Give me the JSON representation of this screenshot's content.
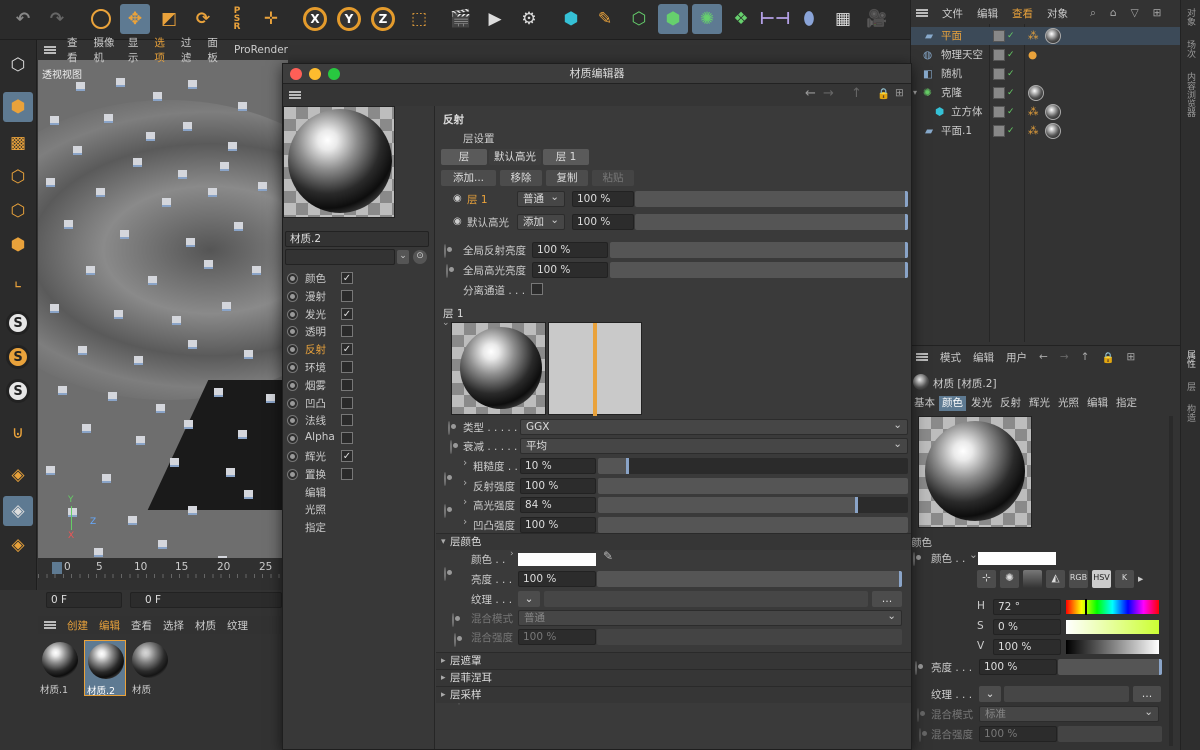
{
  "object_manager": {
    "menu": [
      "文件",
      "编辑",
      "查看",
      "对象"
    ],
    "items": [
      {
        "label": "平面",
        "active": true
      },
      {
        "label": "物理天空",
        "active": false
      },
      {
        "label": "随机",
        "active": false
      },
      {
        "label": "克隆",
        "active": false
      },
      {
        "label": "立方体",
        "active": false
      },
      {
        "label": "平面.1",
        "active": false
      }
    ]
  },
  "side_tabs": [
    "对象",
    "场次",
    "内容浏览器",
    "属性",
    "层",
    "构造"
  ],
  "viewport": {
    "menu": [
      "查看",
      "摄像机",
      "显示",
      "选项",
      "过滤",
      "面板",
      "ProRender"
    ],
    "label": "透视视图",
    "timeline_ticks": [
      "0",
      "5",
      "10",
      "15",
      "20",
      "25"
    ],
    "frame_start": "0 F",
    "frame_current": "0 F"
  },
  "material_manager": {
    "menu": [
      "创建",
      "编辑",
      "查看",
      "选择",
      "材质",
      "纹理"
    ],
    "materials": [
      "材质.1",
      "材质.2",
      "材质"
    ]
  },
  "dialog": {
    "title": "材质编辑器",
    "material_name": "材质.2",
    "channels": [
      {
        "label": "颜色",
        "checked": true
      },
      {
        "label": "漫射",
        "checked": false
      },
      {
        "label": "发光",
        "checked": true
      },
      {
        "label": "透明",
        "checked": false
      },
      {
        "label": "反射",
        "checked": true,
        "active": true
      },
      {
        "label": "环境",
        "checked": false
      },
      {
        "label": "烟雾",
        "checked": false
      },
      {
        "label": "凹凸",
        "checked": false
      },
      {
        "label": "法线",
        "checked": false
      },
      {
        "label": "Alpha",
        "checked": false
      },
      {
        "label": "辉光",
        "checked": true
      },
      {
        "label": "置换",
        "checked": false
      },
      {
        "label": "编辑"
      },
      {
        "label": "光照"
      },
      {
        "label": "指定"
      }
    ],
    "reflection": {
      "heading": "反射",
      "layer_settings": "层设置",
      "layer_tabs": [
        "层",
        "默认高光",
        "层 1"
      ],
      "buttons": [
        "添加...",
        "移除",
        "复制",
        "粘贴"
      ],
      "layers": [
        {
          "name": "层 1",
          "mode": "普通",
          "value": "100 %"
        },
        {
          "name": "默认高光",
          "mode": "添加",
          "value": "100 %"
        }
      ],
      "global_reflect_label": "全局反射亮度",
      "global_reflect_value": "100 %",
      "global_spec_label": "全局高光亮度",
      "global_spec_value": "100 %",
      "separate_label": "分离通道 . . ."
    },
    "layer1": {
      "heading": "层 1",
      "type_label": "类型 . . . . .",
      "type_value": "GGX",
      "falloff_label": "衰减 . . . . .",
      "falloff_value": "平均",
      "rough_label": "粗糙度 . .",
      "rough_value": "10 %",
      "rough_level": 0.1,
      "reflect_label": "反射强度",
      "reflect_value": "100 %",
      "reflect_level": 0.0,
      "spec_label": "高光强度",
      "spec_value": "84 %",
      "spec_level": 0.84,
      "bump_label": "凹凸强度",
      "bump_value": "100 %",
      "bump_level": 0.0
    },
    "layer_color": {
      "heading": "层颜色",
      "color_label": "颜色 . .",
      "brightness_label": "亮度 . . .",
      "brightness_value": "100 %",
      "texture_label": "纹理 . . .",
      "blend_mode_label": "混合模式",
      "blend_mode_value": "普通",
      "blend_strength_label": "混合强度",
      "blend_strength_value": "100 %"
    },
    "collapsed_sections": [
      "层遮罩",
      "层菲涅耳",
      "层采样"
    ]
  },
  "attribute_manager": {
    "menu": [
      "模式",
      "编辑",
      "用户"
    ],
    "title": "材质 [材质.2]",
    "tabs": [
      "基本",
      "颜色",
      "发光",
      "反射",
      "辉光",
      "光照",
      "编辑",
      "指定"
    ],
    "active_tab": "颜色",
    "section": "颜色",
    "color_label": "颜色 . .",
    "mode_buttons": [
      "RGB",
      "HSV",
      "K"
    ],
    "h_label": "H",
    "h_value": "72 °",
    "s_label": "S",
    "s_value": "0 %",
    "v_label": "V",
    "v_value": "100 %",
    "brightness_label": "亮度 . . .",
    "brightness_value": "100 %",
    "texture_label": "纹理 . . .",
    "blend_mode_label": "混合模式",
    "blend_mode_value": "标准",
    "blend_strength_label": "混合强度",
    "blend_strength_value": "100 %"
  },
  "colors": {
    "accent": "#5e7a92",
    "highlight": "#e9a23b",
    "slider_edge": "#8aa4c8"
  }
}
